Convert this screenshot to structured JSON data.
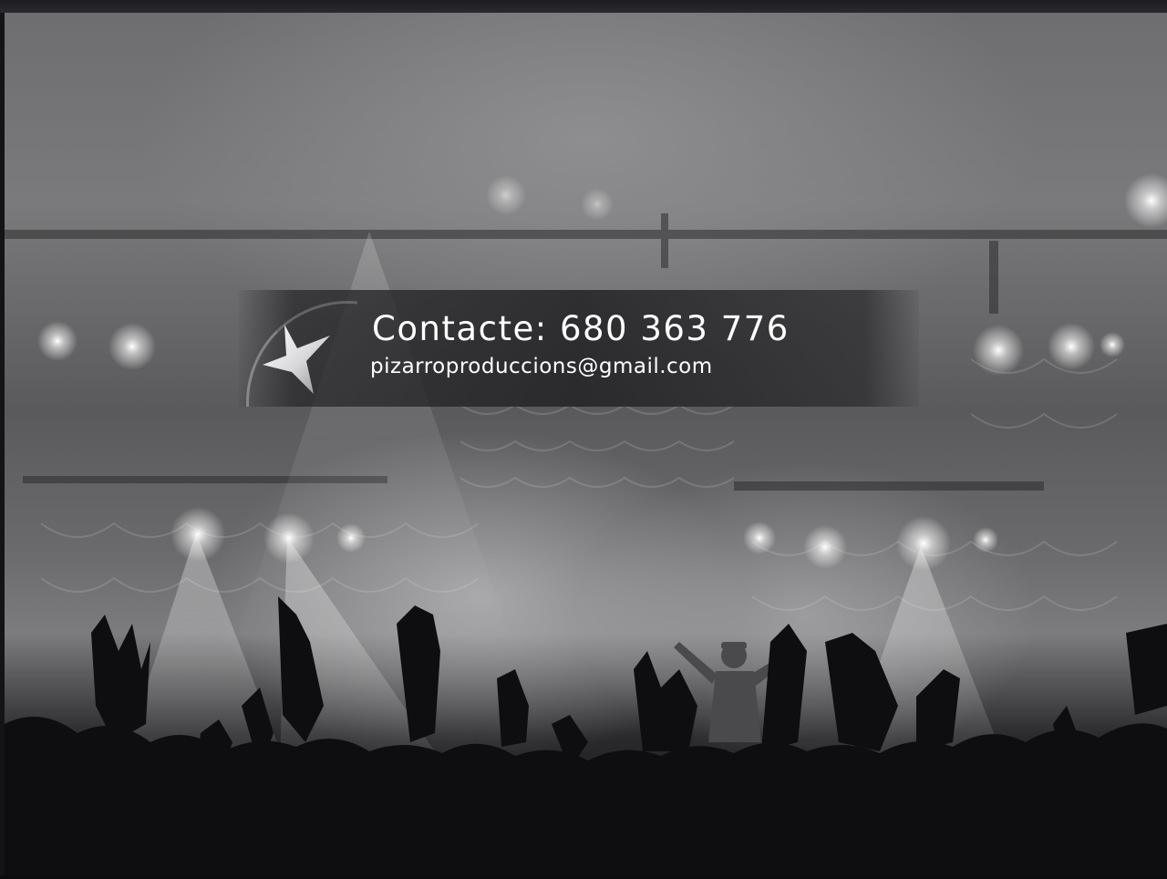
{
  "contact": {
    "phone_line": "Contacte: 680 363 776",
    "email": "pizarroproduccions@gmail.com"
  },
  "colors": {
    "text": "#ffffff",
    "banner": "#232325",
    "crowd": "#0c0c0e"
  },
  "icons": [
    "star-icon"
  ]
}
